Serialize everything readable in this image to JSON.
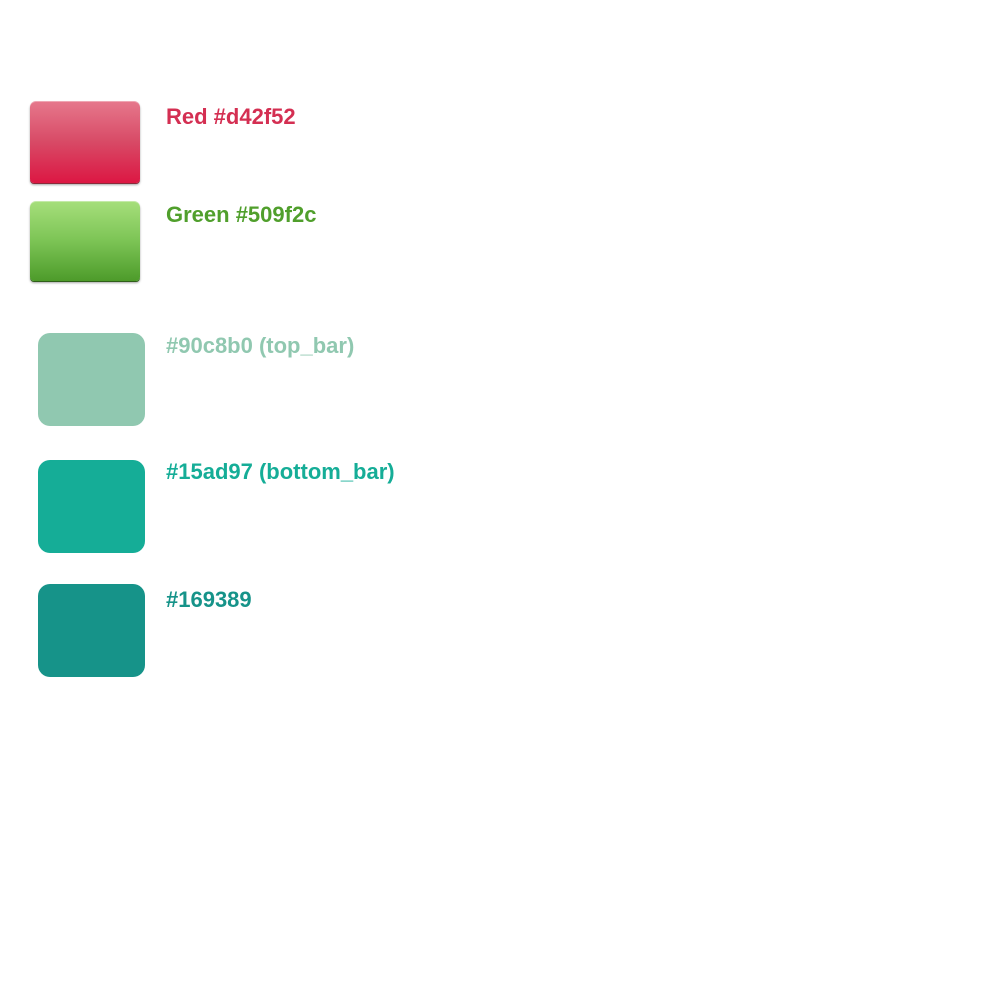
{
  "swatches": [
    {
      "id": "red",
      "label": "Red #d42f52",
      "color": "#d42f52",
      "style": "glossy"
    },
    {
      "id": "green",
      "label": "Green #509f2c",
      "color": "#509f2c",
      "style": "glossy"
    },
    {
      "id": "top_bar",
      "label": "#90c8b0 (top_bar)",
      "color": "#90c8b0",
      "style": "flat"
    },
    {
      "id": "bottom_bar",
      "label": "#15ad97 (bottom_bar)",
      "color": "#15ad97",
      "style": "flat"
    },
    {
      "id": "third",
      "label": "#169389",
      "color": "#169389",
      "style": "flat"
    }
  ]
}
